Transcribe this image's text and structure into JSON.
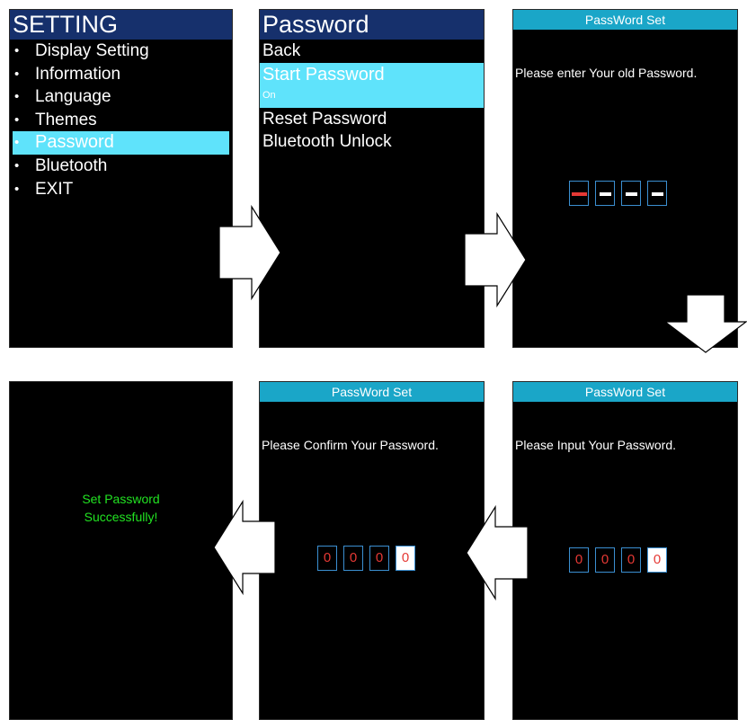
{
  "settings_screen": {
    "title": "SETTING",
    "items": [
      "Display Setting",
      "Information",
      "Language",
      "Themes",
      "Password",
      "Bluetooth",
      "EXIT"
    ],
    "selected_item": "Password"
  },
  "password_menu": {
    "title": "Password",
    "back": "Back",
    "start_password": "Start Password",
    "start_password_state": "On",
    "reset_password": "Reset Password",
    "bluetooth_unlock": "Bluetooth Unlock"
  },
  "old_password_screen": {
    "header": "PassWord Set",
    "prompt": "Please enter Your old Password."
  },
  "input_password_screen": {
    "header": "PassWord Set",
    "prompt": "Please Input Your Password.",
    "digits": [
      "0",
      "0",
      "0",
      "0"
    ]
  },
  "confirm_password_screen": {
    "header": "PassWord Set",
    "prompt": "Please Confirm Your Password.",
    "digits": [
      "0",
      "0",
      "0",
      "0"
    ]
  },
  "success_screen": {
    "line1": "Set Password",
    "line2": "Successfully!"
  },
  "colors": {
    "menu_title_bg": "#16306c",
    "selection_bg": "#5fe3fb",
    "password_header_bg": "#1aa6c8",
    "digit_text": "#e53935",
    "digit_border": "#3b8fd1",
    "success_text": "#22e322",
    "screen_bg": "#000000"
  },
  "icons": [
    "arrow-right-icon",
    "arrow-down-icon",
    "arrow-left-icon"
  ]
}
